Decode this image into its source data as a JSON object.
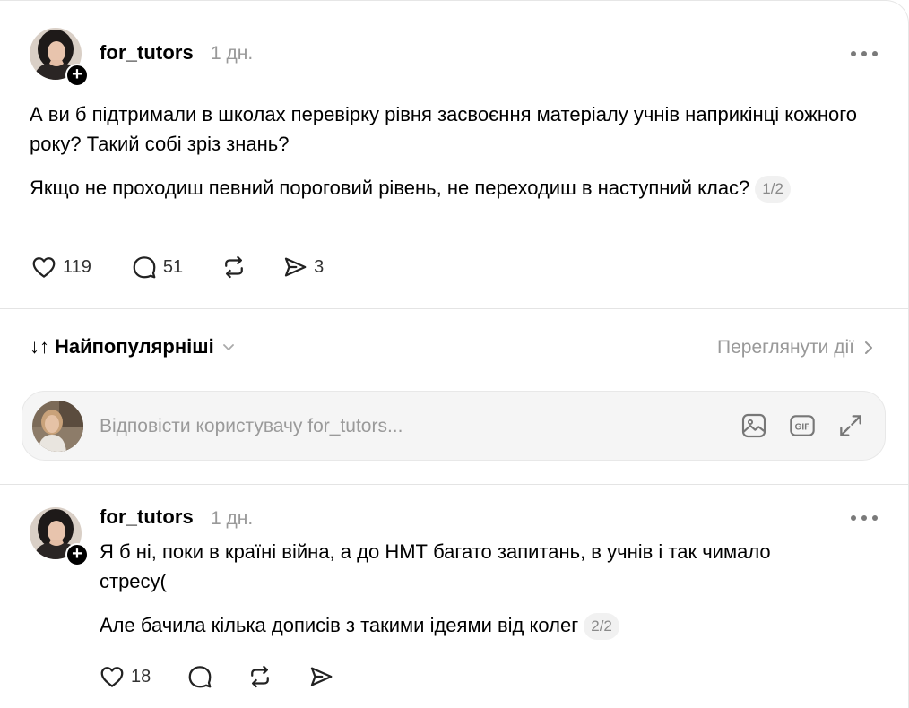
{
  "post": {
    "username": "for_tutors",
    "time": "1 дн.",
    "paragraphs": [
      "А ви б підтримали в школах перевірку рівня засвоєння матеріалу учнів наприкінці кожного року? Такий собі зріз знань?",
      "Якщо не проходиш певний пороговий рівень, не переходиш в наступний клас?"
    ],
    "page_indicator": "1/2",
    "likes": "119",
    "comments": "51",
    "shares": "3"
  },
  "sort": {
    "icon": "↓↑",
    "label": "Найпопулярніші"
  },
  "view_activity": {
    "label": "Переглянути дії"
  },
  "reply": {
    "placeholder": "Відповісти користувачу for_tutors..."
  },
  "reply_post": {
    "username": "for_tutors",
    "time": "1 дн.",
    "paragraphs": [
      "Я б ні, поки в країні війна, а до НМТ багато запитань, в учнів і так чимало стресу(",
      "Але бачила кілька дописів з такими ідеями від колег"
    ],
    "page_indicator": "2/2",
    "likes": "18"
  },
  "icons": {
    "follow": "plus-icon",
    "like": "heart-icon",
    "comment": "comment-bubble-icon",
    "repost": "repost-icon",
    "share": "send-icon",
    "more": "more-dots-icon",
    "chevron_down": "chevron-down-icon",
    "chevron_right": "chevron-right-icon",
    "image": "image-icon",
    "gif": "gif-icon",
    "expand": "expand-icon"
  }
}
